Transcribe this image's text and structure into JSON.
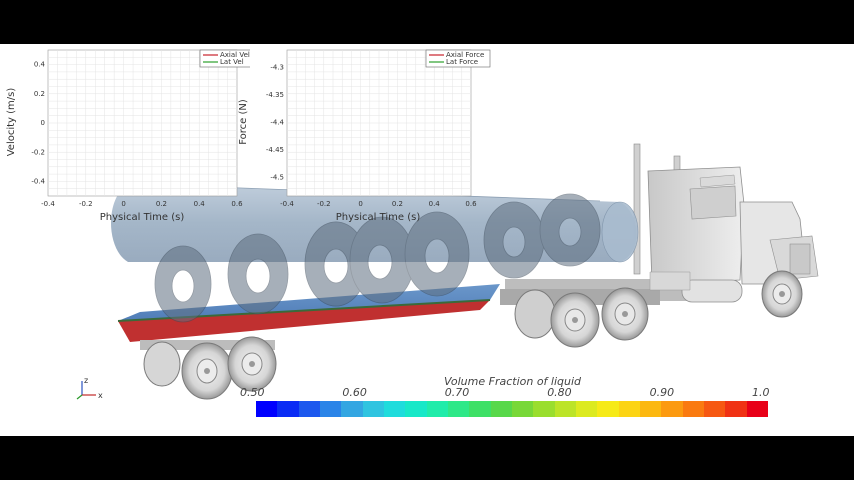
{
  "velocity_plot": {
    "ylabel": "Velocity (m/s)",
    "xlabel": "Physical Time (s)",
    "x_ticks": [
      "-0.4",
      "-0.2",
      "0",
      "0.2",
      "0.4",
      "0.6"
    ],
    "y_ticks": [
      "0.4",
      "0.2",
      "0",
      "-0.2",
      "-0.4"
    ],
    "legend": [
      {
        "label": "Axial Vel",
        "color": "#c8202a"
      },
      {
        "label": "Lat Vel",
        "color": "#2aa02a"
      }
    ]
  },
  "force_plot": {
    "ylabel": "Force (N)",
    "xlabel": "Physical Time (s)",
    "x_ticks": [
      "-0.4",
      "-0.2",
      "0",
      "0.2",
      "0.4",
      "0.6"
    ],
    "y_ticks": [
      "-4.3",
      "-4.35",
      "-4.4",
      "-4.45",
      "-4.5"
    ],
    "legend": [
      {
        "label": "Axial Force",
        "color": "#c8202a"
      },
      {
        "label": "Lat Force",
        "color": "#2aa02a"
      }
    ]
  },
  "colorbar": {
    "title": "Volume Fraction of liquid",
    "labels": [
      "0.50",
      "0.60",
      "0.70",
      "0.80",
      "0.90",
      "1.0"
    ],
    "colors": [
      "#0000ff",
      "#0a2cf5",
      "#1c58ee",
      "#2a84e8",
      "#33a6e2",
      "#2fc4e0",
      "#1fdcdc",
      "#18e8c8",
      "#20ecaa",
      "#2ee888",
      "#3ee066",
      "#58d84a",
      "#78d838",
      "#9ade2e",
      "#bce428",
      "#dcea20",
      "#f6ea18",
      "#fcd414",
      "#fcb810",
      "#fc9a10",
      "#fa7a10",
      "#f65812",
      "#f03214",
      "#e80018"
    ]
  },
  "axis_triad": {
    "z": "z",
    "x": "x"
  }
}
